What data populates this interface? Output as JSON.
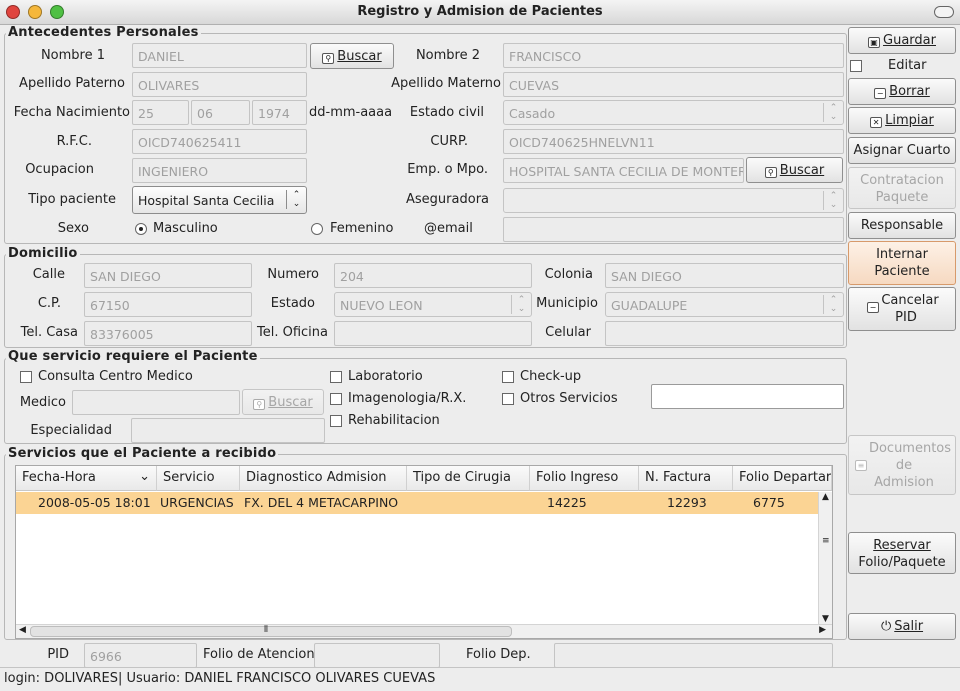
{
  "window": {
    "title": "Registro y Admision de Pacientes"
  },
  "antecedentes": {
    "title": "Antecedentes Personales",
    "nombre1_label": "Nombre 1",
    "nombre1": "DANIEL",
    "buscar1": "Buscar",
    "nombre2_label": "Nombre 2",
    "nombre2": "FRANCISCO",
    "ap_paterno_label": "Apellido Paterno",
    "ap_paterno": "OLIVARES",
    "ap_materno_label": "Apellido Materno",
    "ap_materno": "CUEVAS",
    "fecha_label": "Fecha Nacimiento",
    "fecha_dd": "25",
    "fecha_mm": "06",
    "fecha_aaaa": "1974",
    "fecha_fmt": "dd-mm-aaaa",
    "estado_civil_label": "Estado civil",
    "estado_civil": "Casado",
    "rfc_label": "R.F.C.",
    "rfc": "OICD740625411",
    "curp_label": "CURP.",
    "curp": "OICD740625HNELVN11",
    "ocupacion_label": "Ocupacion",
    "ocupacion": "INGENIERO",
    "emp_label": "Emp. o Mpo.",
    "emp": "HOSPITAL SANTA CECILIA DE MONTERR",
    "buscar2": "Buscar",
    "tipo_label": "Tipo paciente",
    "tipo": "Hospital Santa Cecilia",
    "aseguradora_label": "Aseguradora",
    "aseguradora": "",
    "sexo_label": "Sexo",
    "masculino": "Masculino",
    "femenino": "Femenino",
    "email_label": "@email",
    "email": ""
  },
  "domicilio": {
    "title": "Domicilio",
    "calle_label": "Calle",
    "calle": "SAN DIEGO",
    "numero_label": "Numero",
    "numero": "204",
    "colonia_label": "Colonia",
    "colonia": "SAN DIEGO",
    "cp_label": "C.P.",
    "cp": "67150",
    "estado_label": "Estado",
    "estado": "NUEVO LEON",
    "municipio_label": "Municipio",
    "municipio": "GUADALUPE",
    "telcasa_label": "Tel. Casa",
    "telcasa": "83376005",
    "teloficina_label": "Tel. Oficina",
    "teloficina": "",
    "celular_label": "Celular",
    "celular": ""
  },
  "servicio": {
    "title": "Que servicio requiere el Paciente",
    "consulta": "Consulta Centro Medico",
    "laboratorio": "Laboratorio",
    "checkup": "Check-up",
    "medico_label": "Medico",
    "medico": "",
    "buscar3": "Buscar",
    "imagenologia": "Imagenologia/R.X.",
    "otros": "Otros Servicios",
    "otros_text": "",
    "especialidad_label": "Especialidad",
    "especialidad": "",
    "rehabilitacion": "Rehabilitacion"
  },
  "historial": {
    "title": "Servicios que el Paciente a recibido",
    "columns": [
      "Fecha-Hora",
      "Servicio",
      "Diagnostico Admision",
      "Tipo de Cirugia",
      "Folio Ingreso",
      "N. Factura",
      "Folio Departar"
    ],
    "rows": [
      [
        "2008-05-05 18:01",
        "URGENCIAS",
        "FX. DEL 4 METACARPINO",
        "",
        "14225",
        "12293",
        "6775"
      ]
    ]
  },
  "bottom": {
    "pid_label": "PID",
    "pid": "6966",
    "folio_atencion_label": "Folio de Atencion",
    "folio_atencion": "",
    "folio_dep_label": "Folio Dep.",
    "folio_dep": ""
  },
  "actions": {
    "guardar": "Guardar",
    "editar": "Editar",
    "borrar": "Borrar",
    "limpiar": "Limpiar",
    "asignar": "Asignar Cuarto",
    "contratacion_1": "Contratacion",
    "contratacion_2": "Paquete",
    "responsable": "Responsable",
    "internar_1": "Internar",
    "internar_2": "Paciente",
    "cancelar_1": "Cancelar",
    "cancelar_2": "PID",
    "documentos_1": "Documentos",
    "documentos_2": "de",
    "documentos_3": "Admision",
    "reservar_1": "Reservar",
    "reservar_2": "Folio/Paquete",
    "salir": "Salir"
  },
  "status": {
    "text": "login: DOLIVARES| Usuario: DANIEL FRANCISCO OLIVARES CUEVAS"
  },
  "colors": {
    "selected_row": "#fbd494",
    "highlight_button": "#f6d9c1",
    "close": "#e0443e",
    "minimize": "#f5b73b",
    "maximize": "#4fc043"
  }
}
